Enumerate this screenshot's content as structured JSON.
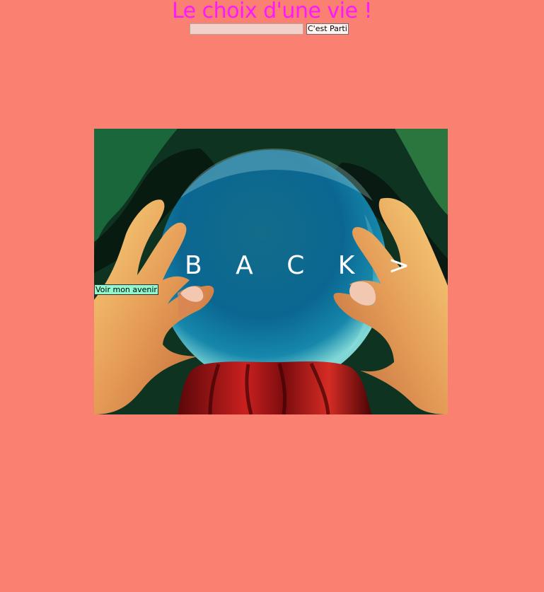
{
  "page": {
    "title": "Le choix d'une vie !",
    "background_color": "#fa8072",
    "title_color": "#ff18ff"
  },
  "form": {
    "name_input_value": "",
    "submit_label": "C'est Parti"
  },
  "visual": {
    "back_label": "B A C K >",
    "future_button_label": "Voir mon avenir",
    "future_button_color": "#8ff8cf",
    "crystal_color": "#0d6b92",
    "cloth_color": "#b11a1d"
  }
}
